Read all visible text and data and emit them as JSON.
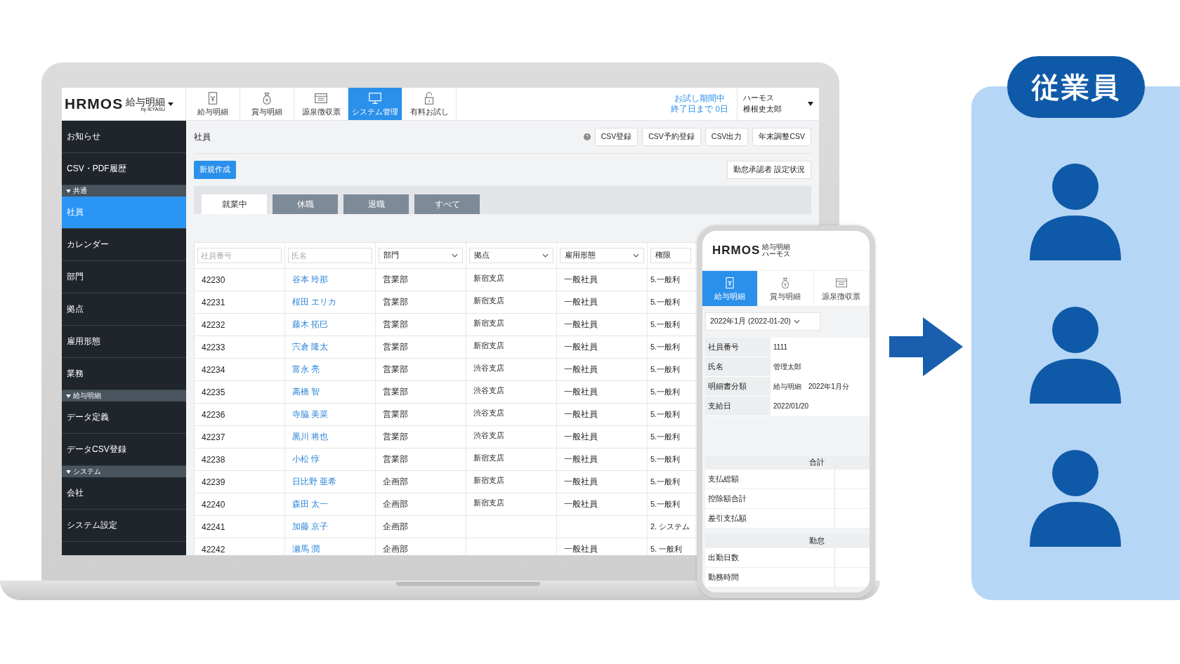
{
  "laptop": {
    "logo": {
      "brand": "HRMOS",
      "product": "給与明細",
      "byline": "by IEYASU"
    },
    "nav_tabs": [
      {
        "label": "給与明細",
        "selected": false
      },
      {
        "label": "賞与明細",
        "selected": false
      },
      {
        "label": "源泉徴収票",
        "selected": false
      },
      {
        "label": "システム管理",
        "selected": true
      },
      {
        "label": "有料お試し",
        "selected": false
      }
    ],
    "trial": {
      "line_1": "お試し期間中",
      "line_2": "終了日まで 0日"
    },
    "account": {
      "company": "ハーモス",
      "user": "椎根史太郎"
    },
    "sidebar": [
      {
        "kind": "item",
        "label": "お知らせ",
        "selected": false
      },
      {
        "kind": "item",
        "label": "CSV・PDF履歴",
        "selected": false
      },
      {
        "kind": "section",
        "label": "共通"
      },
      {
        "kind": "item",
        "label": "社員",
        "selected": true
      },
      {
        "kind": "item",
        "label": "カレンダー",
        "selected": false
      },
      {
        "kind": "item",
        "label": "部門",
        "selected": false
      },
      {
        "kind": "item",
        "label": "拠点",
        "selected": false
      },
      {
        "kind": "item",
        "label": "雇用形態",
        "selected": false
      },
      {
        "kind": "item",
        "label": "業務",
        "selected": false
      },
      {
        "kind": "section",
        "label": "給与明細"
      },
      {
        "kind": "item",
        "label": "データ定義",
        "selected": false
      },
      {
        "kind": "item",
        "label": "データCSV登録",
        "selected": false
      },
      {
        "kind": "section",
        "label": "システム"
      },
      {
        "kind": "item",
        "label": "会社",
        "selected": false
      },
      {
        "kind": "item",
        "label": "システム設定",
        "selected": false
      }
    ],
    "page_title": "社員",
    "toolbar_buttons": [
      "CSV登録",
      "CSV予約登録",
      "CSV出力",
      "年末調整CSV"
    ],
    "new_button": "新規作成",
    "approver_button": "勤怠承認者 設定状況",
    "status_tabs": [
      {
        "label": "就業中",
        "selected": true
      },
      {
        "label": "休職",
        "selected": false
      },
      {
        "label": "退職",
        "selected": false
      },
      {
        "label": "すべて",
        "selected": false
      }
    ],
    "filters": [
      {
        "kind": "input",
        "placeholder": "社員番号"
      },
      {
        "kind": "input",
        "placeholder": "氏名"
      },
      {
        "kind": "select",
        "label": "部門"
      },
      {
        "kind": "select",
        "label": "拠点"
      },
      {
        "kind": "select",
        "label": "雇用形態"
      },
      {
        "kind": "select",
        "label": "権限"
      }
    ],
    "rows": [
      {
        "id": "42230",
        "name": "谷本 玲那",
        "dept": "営業部",
        "site": "新宿支店",
        "type": "一般社員",
        "role": "5.一般利"
      },
      {
        "id": "42231",
        "name": "桜田 エリカ",
        "dept": "営業部",
        "site": "新宿支店",
        "type": "一般社員",
        "role": "5.一般利"
      },
      {
        "id": "42232",
        "name": "藤木 拓巳",
        "dept": "営業部",
        "site": "新宿支店",
        "type": "一般社員",
        "role": "5.一般利"
      },
      {
        "id": "42233",
        "name": "宍倉 隆太",
        "dept": "営業部",
        "site": "新宿支店",
        "type": "一般社員",
        "role": "5.一般利"
      },
      {
        "id": "42234",
        "name": "富永 亮",
        "dept": "営業部",
        "site": "渋谷支店",
        "type": "一般社員",
        "role": "5.一般利"
      },
      {
        "id": "42235",
        "name": "高橋 智",
        "dept": "営業部",
        "site": "渋谷支店",
        "type": "一般社員",
        "role": "5.一般利"
      },
      {
        "id": "42236",
        "name": "寺脇 美菜",
        "dept": "営業部",
        "site": "渋谷支店",
        "type": "一般社員",
        "role": "5.一般利"
      },
      {
        "id": "42237",
        "name": "黒川 将也",
        "dept": "営業部",
        "site": "渋谷支店",
        "type": "一般社員",
        "role": "5.一般利"
      },
      {
        "id": "42238",
        "name": "小松 惇",
        "dept": "営業部",
        "site": "新宿支店",
        "type": "一般社員",
        "role": "5.一般利"
      },
      {
        "id": "42239",
        "name": "日比野 亜希",
        "dept": "企画部",
        "site": "新宿支店",
        "type": "一般社員",
        "role": "5.一般利"
      },
      {
        "id": "42240",
        "name": "森田 太一",
        "dept": "企画部",
        "site": "新宿支店",
        "type": "一般社員",
        "role": "5.一般利"
      },
      {
        "id": "42241",
        "name": "加藤 京子",
        "dept": "企画部",
        "role": "2. システム"
      },
      {
        "id": "42242",
        "name": "瀬馬 潤",
        "dept": "企画部",
        "type": "一般社員",
        "role": "5. 一般利"
      }
    ]
  },
  "phone": {
    "logo": {
      "brand": "HRMOS",
      "product": "給与明細",
      "byline": "ハーモス"
    },
    "tabs": [
      {
        "label": "給与明細",
        "selected": true
      },
      {
        "label": "賞与明細",
        "selected": false
      },
      {
        "label": "源泉徴収票",
        "selected": false
      }
    ],
    "period": "2022年1月 (2022-01-20)",
    "info": [
      {
        "label": "社員番号",
        "value": "1111"
      },
      {
        "label": "氏名",
        "value": "管理太郎"
      },
      {
        "label": "明細書分類",
        "value": "給与明細　2022年1月分"
      },
      {
        "label": "支給日",
        "value": "2022/01/20"
      }
    ],
    "sections": [
      {
        "title": "合計",
        "rows": [
          "支払総額",
          "控除額合計",
          "差引支払額"
        ]
      },
      {
        "title": "勤怠",
        "rows": [
          "出勤日数",
          "勤務時間"
        ]
      }
    ]
  },
  "employees_panel": {
    "title": "従業員"
  }
}
